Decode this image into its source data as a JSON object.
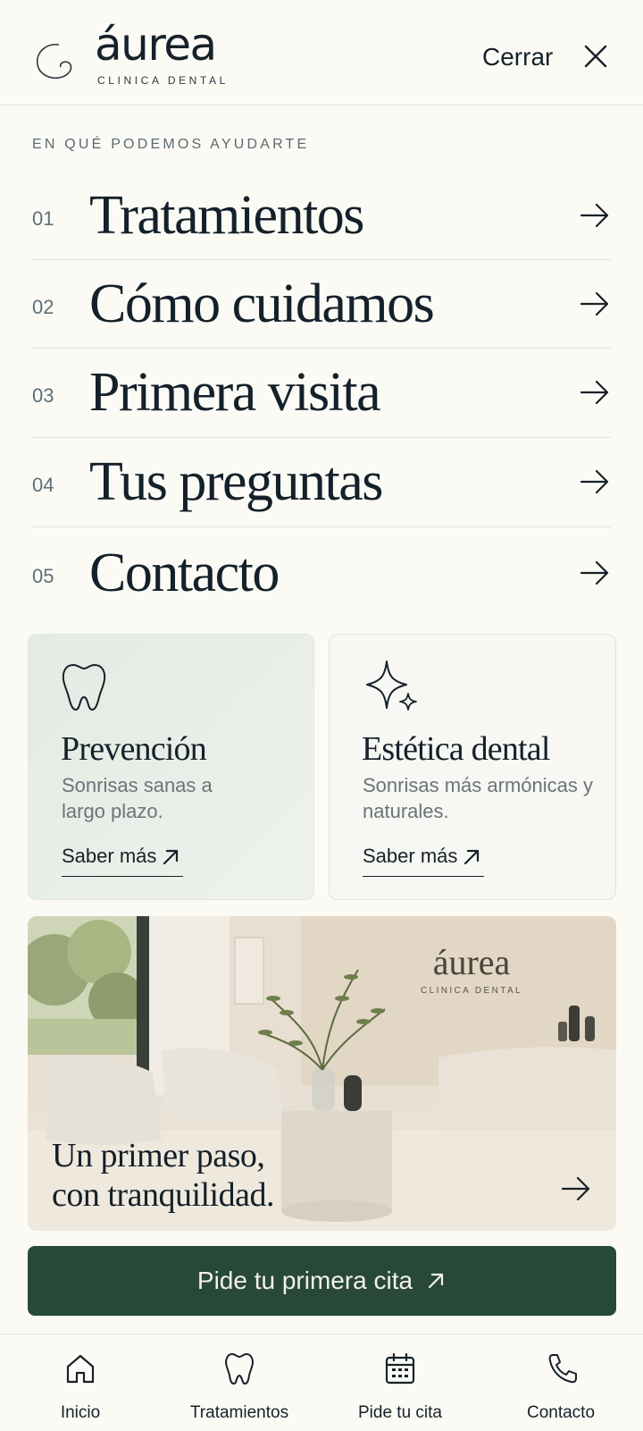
{
  "brand": {
    "name": "áurea",
    "tagline": "CLINICA DENTAL"
  },
  "header": {
    "close_label": "Cerrar"
  },
  "menu": {
    "section_label": "EN QUÉ PODEMOS AYUDARTE",
    "items": [
      {
        "number": "01",
        "label": "Tratamientos"
      },
      {
        "number": "02",
        "label": "Cómo cuidamos"
      },
      {
        "number": "03",
        "label": "Primera visita"
      },
      {
        "number": "04",
        "label": "Tus preguntas"
      },
      {
        "number": "05",
        "label": "Contacto"
      }
    ]
  },
  "cards": [
    {
      "icon": "tooth-icon",
      "title": "Prevención",
      "description": "Sonrisas sanas a largo plazo.",
      "link": "Saber más"
    },
    {
      "icon": "sparkle-icon",
      "title": "Estética dental",
      "description": "Sonrisas más armónicas y naturales.",
      "link": "Saber más"
    }
  ],
  "hero": {
    "caption_line1": "Un primer paso,",
    "caption_line2": "con tranquilidad.",
    "sign_name": "áurea",
    "sign_tagline": "CLINICA DENTAL"
  },
  "cta": {
    "label": "Pide tu primera cita"
  },
  "bottom_nav": [
    {
      "icon": "home-icon",
      "label": "Inicio"
    },
    {
      "icon": "tooth-icon",
      "label": "Tratamientos"
    },
    {
      "icon": "calendar-icon",
      "label": "Pide tu cita"
    },
    {
      "icon": "phone-icon",
      "label": "Contacto"
    }
  ],
  "colors": {
    "background": "#fbfaf5",
    "text": "#16212a",
    "accent_green": "#28483a",
    "card_green": "#e3ebe3"
  }
}
